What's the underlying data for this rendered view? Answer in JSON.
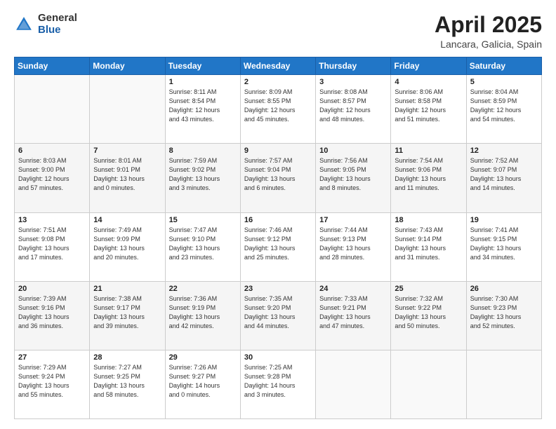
{
  "header": {
    "logo_general": "General",
    "logo_blue": "Blue",
    "title": "April 2025",
    "subtitle": "Lancara, Galicia, Spain"
  },
  "weekdays": [
    "Sunday",
    "Monday",
    "Tuesday",
    "Wednesday",
    "Thursday",
    "Friday",
    "Saturday"
  ],
  "weeks": [
    [
      {
        "num": "",
        "info": ""
      },
      {
        "num": "",
        "info": ""
      },
      {
        "num": "1",
        "info": "Sunrise: 8:11 AM\nSunset: 8:54 PM\nDaylight: 12 hours\nand 43 minutes."
      },
      {
        "num": "2",
        "info": "Sunrise: 8:09 AM\nSunset: 8:55 PM\nDaylight: 12 hours\nand 45 minutes."
      },
      {
        "num": "3",
        "info": "Sunrise: 8:08 AM\nSunset: 8:57 PM\nDaylight: 12 hours\nand 48 minutes."
      },
      {
        "num": "4",
        "info": "Sunrise: 8:06 AM\nSunset: 8:58 PM\nDaylight: 12 hours\nand 51 minutes."
      },
      {
        "num": "5",
        "info": "Sunrise: 8:04 AM\nSunset: 8:59 PM\nDaylight: 12 hours\nand 54 minutes."
      }
    ],
    [
      {
        "num": "6",
        "info": "Sunrise: 8:03 AM\nSunset: 9:00 PM\nDaylight: 12 hours\nand 57 minutes."
      },
      {
        "num": "7",
        "info": "Sunrise: 8:01 AM\nSunset: 9:01 PM\nDaylight: 13 hours\nand 0 minutes."
      },
      {
        "num": "8",
        "info": "Sunrise: 7:59 AM\nSunset: 9:02 PM\nDaylight: 13 hours\nand 3 minutes."
      },
      {
        "num": "9",
        "info": "Sunrise: 7:57 AM\nSunset: 9:04 PM\nDaylight: 13 hours\nand 6 minutes."
      },
      {
        "num": "10",
        "info": "Sunrise: 7:56 AM\nSunset: 9:05 PM\nDaylight: 13 hours\nand 8 minutes."
      },
      {
        "num": "11",
        "info": "Sunrise: 7:54 AM\nSunset: 9:06 PM\nDaylight: 13 hours\nand 11 minutes."
      },
      {
        "num": "12",
        "info": "Sunrise: 7:52 AM\nSunset: 9:07 PM\nDaylight: 13 hours\nand 14 minutes."
      }
    ],
    [
      {
        "num": "13",
        "info": "Sunrise: 7:51 AM\nSunset: 9:08 PM\nDaylight: 13 hours\nand 17 minutes."
      },
      {
        "num": "14",
        "info": "Sunrise: 7:49 AM\nSunset: 9:09 PM\nDaylight: 13 hours\nand 20 minutes."
      },
      {
        "num": "15",
        "info": "Sunrise: 7:47 AM\nSunset: 9:10 PM\nDaylight: 13 hours\nand 23 minutes."
      },
      {
        "num": "16",
        "info": "Sunrise: 7:46 AM\nSunset: 9:12 PM\nDaylight: 13 hours\nand 25 minutes."
      },
      {
        "num": "17",
        "info": "Sunrise: 7:44 AM\nSunset: 9:13 PM\nDaylight: 13 hours\nand 28 minutes."
      },
      {
        "num": "18",
        "info": "Sunrise: 7:43 AM\nSunset: 9:14 PM\nDaylight: 13 hours\nand 31 minutes."
      },
      {
        "num": "19",
        "info": "Sunrise: 7:41 AM\nSunset: 9:15 PM\nDaylight: 13 hours\nand 34 minutes."
      }
    ],
    [
      {
        "num": "20",
        "info": "Sunrise: 7:39 AM\nSunset: 9:16 PM\nDaylight: 13 hours\nand 36 minutes."
      },
      {
        "num": "21",
        "info": "Sunrise: 7:38 AM\nSunset: 9:17 PM\nDaylight: 13 hours\nand 39 minutes."
      },
      {
        "num": "22",
        "info": "Sunrise: 7:36 AM\nSunset: 9:19 PM\nDaylight: 13 hours\nand 42 minutes."
      },
      {
        "num": "23",
        "info": "Sunrise: 7:35 AM\nSunset: 9:20 PM\nDaylight: 13 hours\nand 44 minutes."
      },
      {
        "num": "24",
        "info": "Sunrise: 7:33 AM\nSunset: 9:21 PM\nDaylight: 13 hours\nand 47 minutes."
      },
      {
        "num": "25",
        "info": "Sunrise: 7:32 AM\nSunset: 9:22 PM\nDaylight: 13 hours\nand 50 minutes."
      },
      {
        "num": "26",
        "info": "Sunrise: 7:30 AM\nSunset: 9:23 PM\nDaylight: 13 hours\nand 52 minutes."
      }
    ],
    [
      {
        "num": "27",
        "info": "Sunrise: 7:29 AM\nSunset: 9:24 PM\nDaylight: 13 hours\nand 55 minutes."
      },
      {
        "num": "28",
        "info": "Sunrise: 7:27 AM\nSunset: 9:25 PM\nDaylight: 13 hours\nand 58 minutes."
      },
      {
        "num": "29",
        "info": "Sunrise: 7:26 AM\nSunset: 9:27 PM\nDaylight: 14 hours\nand 0 minutes."
      },
      {
        "num": "30",
        "info": "Sunrise: 7:25 AM\nSunset: 9:28 PM\nDaylight: 14 hours\nand 3 minutes."
      },
      {
        "num": "",
        "info": ""
      },
      {
        "num": "",
        "info": ""
      },
      {
        "num": "",
        "info": ""
      }
    ]
  ]
}
